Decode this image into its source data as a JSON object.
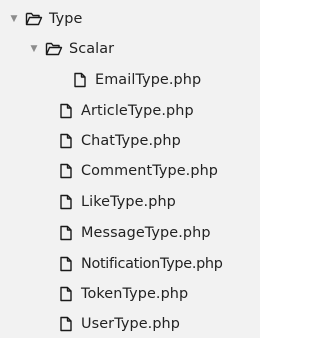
{
  "tree": {
    "root": {
      "label": "Type",
      "expanded": true,
      "icon": "folder-open-icon"
    },
    "scalar": {
      "label": "Scalar",
      "expanded": true,
      "icon": "folder-open-icon"
    },
    "files": [
      {
        "label": "EmailType.php",
        "icon": "file-icon"
      },
      {
        "label": "ArticleType.php",
        "icon": "file-icon"
      },
      {
        "label": "ChatType.php",
        "icon": "file-icon"
      },
      {
        "label": "CommentType.php",
        "icon": "file-icon"
      },
      {
        "label": "LikeType.php",
        "icon": "file-icon"
      },
      {
        "label": "MessageType.php",
        "icon": "file-icon"
      },
      {
        "label": "NotificationType.php",
        "icon": "file-icon"
      },
      {
        "label": "TokenType.php",
        "icon": "file-icon"
      },
      {
        "label": "UserType.php",
        "icon": "file-icon"
      }
    ],
    "expand_glyph": "▼"
  },
  "colors": {
    "panel_background": "#f2f2f2",
    "text": "#222222",
    "twisty": "#8c8c8c",
    "icon_stroke": "#1a1a1a"
  }
}
